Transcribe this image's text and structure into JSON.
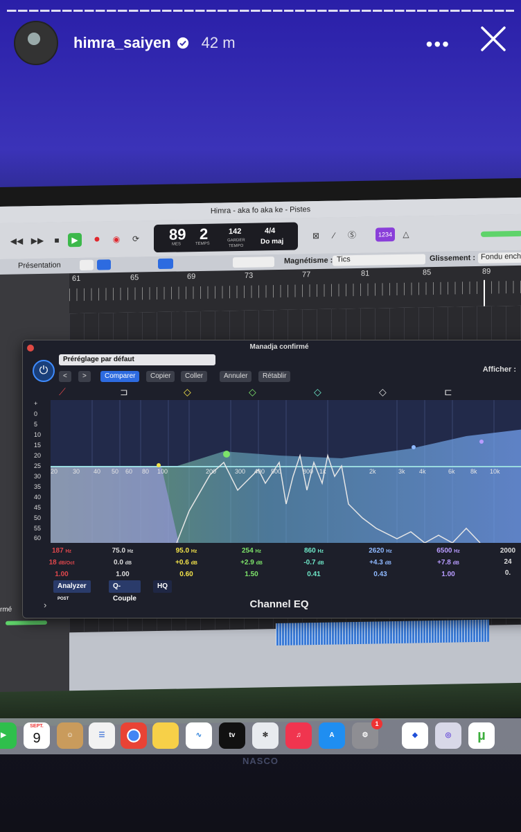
{
  "story": {
    "username": "himra_saiyen",
    "time": "42 m",
    "more": "•••"
  },
  "daw": {
    "window_title": "Himra - aka fo aka ke - Pistes",
    "lcd": {
      "bar": "89",
      "beat": "2",
      "bar_label": "MES",
      "beat_label": "TEMPS",
      "tempo": "142",
      "tempo_label": "TEMPO",
      "keep": "GARDER",
      "signature": "4/4",
      "key": "Do maj"
    },
    "count_in": "1234",
    "presentation": "Présentation",
    "magnetism_label": "Magnétisme :",
    "magnetism_value": "Tics",
    "glissement_label": "Glissement :",
    "glissement_value": "Fondu ench",
    "ruler_bars": [
      "61",
      "65",
      "69",
      "73",
      "77",
      "81",
      "85",
      "89"
    ],
    "track_label": "rmé"
  },
  "plugin": {
    "title": "Manadja confirmé",
    "preset": "Préréglage par défaut",
    "buttons": {
      "prev": "<",
      "next": ">",
      "compare": "Comparer",
      "copy": "Copier",
      "paste": "Coller",
      "undo": "Annuler",
      "redo": "Rétablir"
    },
    "afficher": "Afficher :",
    "db_scale": [
      "+",
      "0",
      "5",
      "10",
      "15",
      "20",
      "25",
      "30",
      "35",
      "40",
      "45",
      "50",
      "55",
      "60"
    ],
    "freq_labels": [
      "20",
      "30",
      "40",
      "50",
      "60",
      "80",
      "100",
      "200",
      "300",
      "400",
      "500",
      "800",
      "1k",
      "2k",
      "3k",
      "4k",
      "6k",
      "8k",
      "10k"
    ],
    "bands": [
      {
        "freq": "187",
        "unit": "Hz",
        "gain": "18",
        "gain_unit": "dB/Oct",
        "q": "1.00",
        "color": "#e0474c"
      },
      {
        "freq": "75.0",
        "unit": "Hz",
        "gain": "0.0",
        "gain_unit": "dB",
        "q": "1.00",
        "color": "#dddddd"
      },
      {
        "freq": "95.0",
        "unit": "Hz",
        "gain": "+0.6",
        "gain_unit": "dB",
        "q": "0.60",
        "color": "#f2e24a"
      },
      {
        "freq": "254",
        "unit": "Hz",
        "gain": "+2.9",
        "gain_unit": "dB",
        "q": "1.50",
        "color": "#7de36a"
      },
      {
        "freq": "860",
        "unit": "Hz",
        "gain": "-0.7",
        "gain_unit": "dB",
        "q": "0.41",
        "color": "#6ee6c7"
      },
      {
        "freq": "2620",
        "unit": "Hz",
        "gain": "+4.3",
        "gain_unit": "dB",
        "q": "0.43",
        "color": "#8fb9ff"
      },
      {
        "freq": "6500",
        "unit": "Hz",
        "gain": "+7.8",
        "gain_unit": "dB",
        "q": "1.00",
        "color": "#b89cff"
      },
      {
        "freq": "2000",
        "unit": "",
        "gain": "24",
        "gain_unit": "",
        "q": "0.",
        "color": "#dddddd"
      }
    ],
    "analyzer": "Analyzer",
    "analyzer_mode": "POST",
    "qcouple": "Q-Couple",
    "hq": "HQ",
    "name": "Channel EQ"
  },
  "dock": {
    "calendar_month": "SEPT.",
    "calendar_day": "9",
    "tv": "tv",
    "notification_badge": "1"
  },
  "brand": "NASCO"
}
